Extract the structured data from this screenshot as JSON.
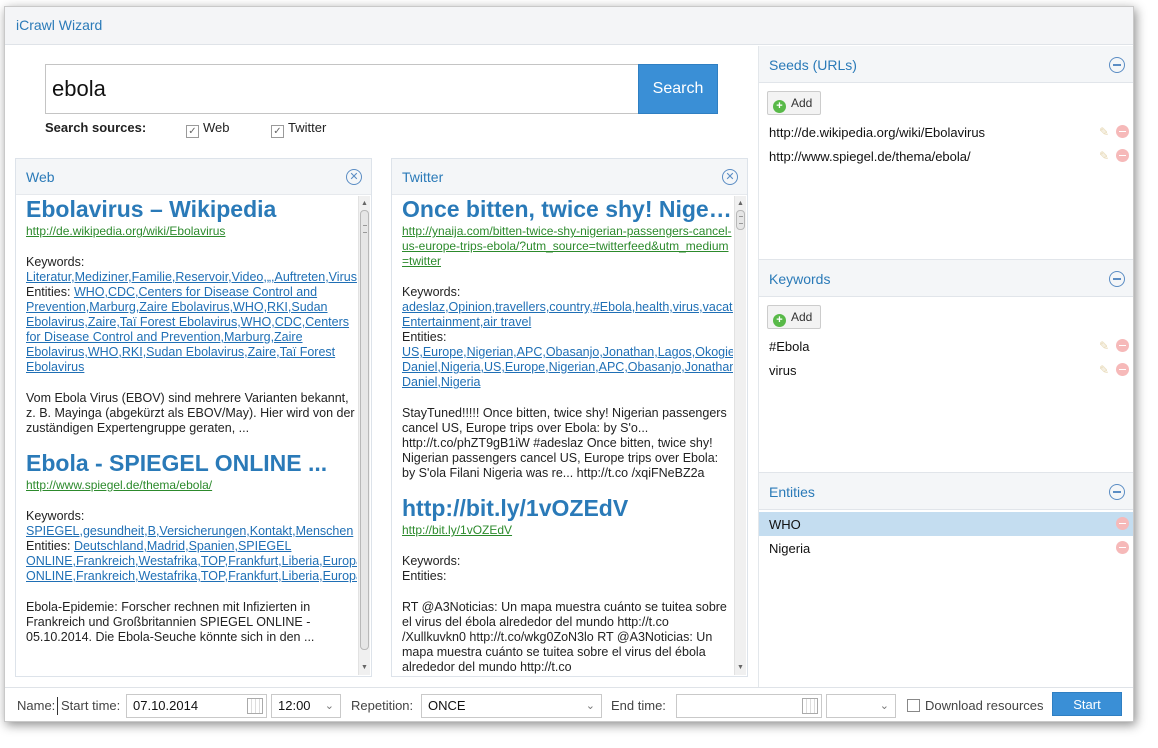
{
  "app": {
    "title": "iCrawl Wizard"
  },
  "search": {
    "value": "ebola",
    "button_label": "Search",
    "sources_label": "Search sources:",
    "sources": [
      {
        "label": "Web",
        "checked": true
      },
      {
        "label": "Twitter",
        "checked": true
      }
    ]
  },
  "web_panel": {
    "title": "Web",
    "results": [
      {
        "title": "Ebolavirus – Wikipedia",
        "url": "http://de.wikipedia.org/wiki/Ebolavirus",
        "keywords_label": "Keywords:",
        "keywords": "Literatur,Mediziner,Familie,Reservoir,Video,„,Auftreten,Virus",
        "entities_label": "Entities:",
        "entities": "WHO,CDC,Centers for Disease Control and Prevention,Marburg,Zaire Ebolavirus,WHO,RKI,Sudan Ebolavirus,Zaire,Taï Forest Ebolavirus,WHO,CDC,Centers for Disease Control and Prevention,Marburg,Zaire Ebolavirus,WHO,RKI,Sudan Ebolavirus,Zaire,Taï Forest Ebolavirus",
        "snippet": "Vom Ebola Virus (EBOV) sind mehrere Varianten bekannt, z. B. Mayinga (abgekürzt als EBOV/May). Hier wird von der zuständigen Expertengruppe geraten, ..."
      },
      {
        "title": "Ebola - SPIEGEL ONLINE ...",
        "url": "http://www.spiegel.de/thema/ebola/",
        "keywords_label": "Keywords:",
        "keywords": "SPIEGEL,gesundheit,B,Versicherungen,Kontakt,Menschen",
        "entities_label": "Entities:",
        "entities_line1": "Deutschland,Madrid,Spanien,SPIEGEL",
        "entities_line2": "ONLINE,Frankreich,Westafrika,TOP,Frankfurt,Liberia,Europa",
        "entities_line3": "ONLINE,Frankreich,Westafrika,TOP,Frankfurt,Liberia,Europa",
        "snippet": "Ebola-Epidemie: Forscher rechnen mit Infizierten in Frankreich und Großbritannien SPIEGEL ONLINE - 05.10.2014. Die Ebola-Seuche könnte sich in den ..."
      }
    ]
  },
  "twitter_panel": {
    "title": "Twitter",
    "results": [
      {
        "title": "Once bitten, twice shy! Nigerian ...",
        "url": "http://ynaija.com/bitten-twice-shy-nigerian-passengers-cancel-us-europe-trips-ebola/?utm_source=twitterfeed&utm_medium=twitter",
        "keywords_label": "Keywords:",
        "keywords_line1": "adeslaz,Opinion,travellers,country,#Ebola,health,virus,vacation",
        "keywords_line2": "Entertainment,air travel",
        "entities_label": "Entities:",
        "entities_line1": "US,Europe,Nigerian,APC,Obasanjo,Jonathan,Lagos,Okogie",
        "entities_line2": "Daniel,Nigeria,US,Europe,Nigerian,APC,Obasanjo,Jonathan",
        "entities_line3": "Daniel,Nigeria",
        "snippet": "StayTuned!!!!! Once bitten, twice shy! Nigerian passengers cancel US, Europe trips over Ebola: by S'o... http://t.co/phZT9gB1iW #adeslaz Once bitten, twice shy! Nigerian passengers cancel US, Europe trips over Ebola: by S'ola Filani Nigeria was re... http://t.co /xqiFNeBZ2a"
      },
      {
        "title": "http://bit.ly/1vOZEdV",
        "url": "http://bit.ly/1vOZEdV",
        "keywords_label": "Keywords:",
        "entities_label": "Entities:",
        "snippet": "RT @A3Noticias: Un mapa muestra cuánto se tuitea sobre el virus del ébola alrededor del mundo http://t.co /Xullkuvkn0 http://t.co/wkg0ZoN3lo RT @A3Noticias: Un mapa muestra cuánto se tuitea sobre el virus del ébola alrededor del mundo http://t.co"
      }
    ]
  },
  "seeds": {
    "title": "Seeds (URLs)",
    "add_label": "Add",
    "items": [
      "http://de.wikipedia.org/wiki/Ebolavirus",
      "http://www.spiegel.de/thema/ebola/"
    ]
  },
  "keywords": {
    "title": "Keywords",
    "add_label": "Add",
    "items": [
      "#Ebola",
      "virus"
    ]
  },
  "entities": {
    "title": "Entities",
    "items": [
      "WHO",
      "Nigeria"
    ],
    "selected": "WHO"
  },
  "bottom": {
    "name_label": "Name:",
    "start_time_label": "Start time:",
    "start_date": "07.10.2014",
    "start_hour": "12:00",
    "repetition_label": "Repetition:",
    "repetition_value": "ONCE",
    "end_time_label": "End time:",
    "end_date": "",
    "end_hour": "",
    "download_label": "Download resources",
    "download_checked": false,
    "start_button": "Start"
  },
  "colors": {
    "accent": "#2a7ab8",
    "button": "#3a8fd6",
    "url_green": "#2c8a2c",
    "selected_row": "#c4ddf0"
  }
}
